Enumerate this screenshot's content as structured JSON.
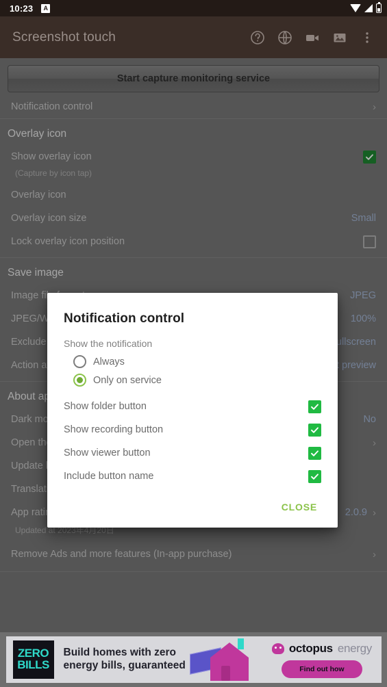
{
  "status_bar": {
    "time": "10:23",
    "badge": "A",
    "icons": [
      "wifi-icon",
      "signal-icon",
      "battery-icon"
    ]
  },
  "app_bar": {
    "title": "Screenshot touch",
    "actions": [
      {
        "name": "help-icon",
        "label": "Help"
      },
      {
        "name": "language-globe-icon",
        "label": "Language"
      },
      {
        "name": "video-camera-icon",
        "label": "Recording"
      },
      {
        "name": "gallery-image-icon",
        "label": "Viewer"
      },
      {
        "name": "overflow-menu-icon",
        "label": "More options"
      }
    ]
  },
  "main": {
    "start_button": "Start capture monitoring service",
    "notification_control_row": {
      "label": "Notification control",
      "chevron": "›"
    },
    "sections": [
      {
        "title": "Overlay icon",
        "rows": [
          {
            "label": "Show overlay icon",
            "sub": "(Capture by icon tap)",
            "control": "checkbox",
            "checked": true
          },
          {
            "label": "Overlay icon",
            "control": "none"
          },
          {
            "label": "Overlay icon size",
            "value": "Small",
            "control": "none"
          },
          {
            "label": "Lock overlay icon position",
            "control": "checkbox",
            "checked": false
          }
        ]
      },
      {
        "title": "Save image",
        "rows": [
          {
            "label": "Image file format",
            "value": "JPEG",
            "control": "none"
          },
          {
            "label": "JPEG/WEBP quality",
            "value": "100%",
            "control": "none"
          },
          {
            "label": "Exclude status bar",
            "value": "Fullscreen",
            "control": "none"
          },
          {
            "label": "Action after capture",
            "value": "Last preview",
            "control": "none"
          }
        ]
      },
      {
        "title": "About app",
        "rows": [
          {
            "label": "Dark mode",
            "value": "No",
            "control": "none"
          },
          {
            "label": "Open the web site",
            "chevron": "›",
            "control": "none"
          },
          {
            "label": "Update history",
            "control": "none"
          },
          {
            "label": "Translation help",
            "control": "none"
          },
          {
            "label": "App rating",
            "sub": "Updated at 2023年4月20日",
            "value": "2.0.9",
            "chevron": "›",
            "control": "none"
          },
          {
            "label": "Remove Ads and more features (In-app purchase)",
            "chevron": "›",
            "control": "none"
          }
        ]
      }
    ]
  },
  "dialog": {
    "title": "Notification control",
    "group_label": "Show the notification",
    "radios": [
      {
        "label": "Always",
        "checked": false
      },
      {
        "label": "Only on service",
        "checked": true
      }
    ],
    "checkboxes": [
      {
        "label": "Show folder button",
        "checked": true
      },
      {
        "label": "Show recording button",
        "checked": true
      },
      {
        "label": "Show viewer button",
        "checked": true
      },
      {
        "label": "Include button name",
        "checked": true
      }
    ],
    "close_label": "CLOSE"
  },
  "ad": {
    "logo_line1": "ZERO",
    "logo_line2": "BILLS",
    "headline_line1": "Build homes with zero",
    "headline_line2": "energy bills, guaranteed",
    "brand_bold": "octopus",
    "brand_light": "energy",
    "cta": "Find out how"
  },
  "colors": {
    "status_bar_bg": "#231a16",
    "app_bar_bg": "#3a2d27",
    "page_bg": "#6e6e6e",
    "accent_green": "#8bc34a",
    "checkbox_green": "#20ba42",
    "value_blue": "#9fb4d8",
    "ad_magenta": "#c0379c",
    "ad_teal": "#2fd9c9"
  }
}
